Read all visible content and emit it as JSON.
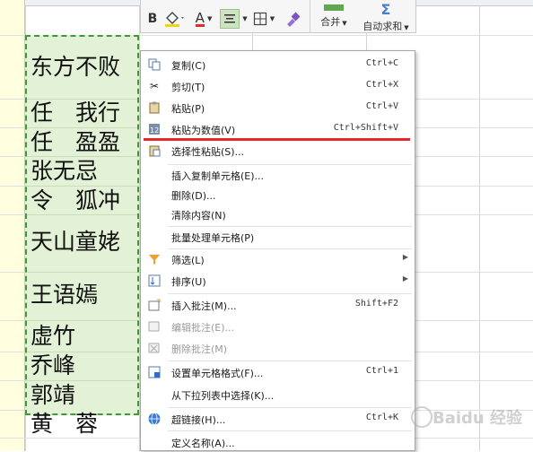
{
  "cells": [
    "东方不败",
    "任　我行",
    "任　盈盈",
    "张无忌",
    "令　狐冲",
    "天山童姥",
    "王语嫣",
    "虚竹",
    "乔峰",
    "郭靖",
    "黄　蓉"
  ],
  "toolbar": {
    "merge_label": "合并",
    "autosum_label": "自动求和",
    "bold": "B",
    "font_color_letter": "A"
  },
  "menu": [
    {
      "label": "复制(C)",
      "shortcut": "Ctrl+C",
      "icon": "copy-icon"
    },
    {
      "label": "剪切(T)",
      "shortcut": "Ctrl+X",
      "icon": "scissors-icon"
    },
    {
      "label": "粘贴(P)",
      "shortcut": "Ctrl+V",
      "icon": "paste-icon"
    },
    {
      "label": "粘贴为数值(V)",
      "shortcut": "Ctrl+Shift+V",
      "icon": "paste-values-icon"
    },
    {
      "label": "选择性粘贴(S)...",
      "shortcut": "",
      "icon": "paste-special-icon"
    },
    {
      "label": "插入复制单元格(E)...",
      "shortcut": ""
    },
    {
      "label": "删除(D)...",
      "shortcut": ""
    },
    {
      "label": "清除内容(N)",
      "shortcut": ""
    },
    {
      "label": "批量处理单元格(P)",
      "shortcut": ""
    },
    {
      "label": "筛选(L)",
      "shortcut": "",
      "icon": "filter-icon",
      "submenu": true
    },
    {
      "label": "排序(U)",
      "shortcut": "",
      "icon": "sort-icon",
      "submenu": true
    },
    {
      "label": "插入批注(M)...",
      "shortcut": "Shift+F2",
      "icon": "insert-comment-icon"
    },
    {
      "label": "编辑批注(E)...",
      "shortcut": "",
      "icon": "edit-comment-icon",
      "disabled": true
    },
    {
      "label": "删除批注(M)",
      "shortcut": "",
      "icon": "delete-comment-icon",
      "disabled": true
    },
    {
      "label": "设置单元格格式(F)...",
      "shortcut": "Ctrl+1",
      "icon": "format-cells-icon"
    },
    {
      "label": "从下拉列表中选择(K)...",
      "shortcut": ""
    },
    {
      "label": "超链接(H)...",
      "shortcut": "Ctrl+K",
      "icon": "hyperlink-icon"
    },
    {
      "label": "定义名称(A)...",
      "shortcut": ""
    }
  ],
  "watermark": "Baidu 经验",
  "colors": {
    "selection_fill": "#e3f2d6",
    "selection_border": "#3d9b35",
    "highlight_line": "#e8262b",
    "column_a_fill": "#ffffe0"
  }
}
